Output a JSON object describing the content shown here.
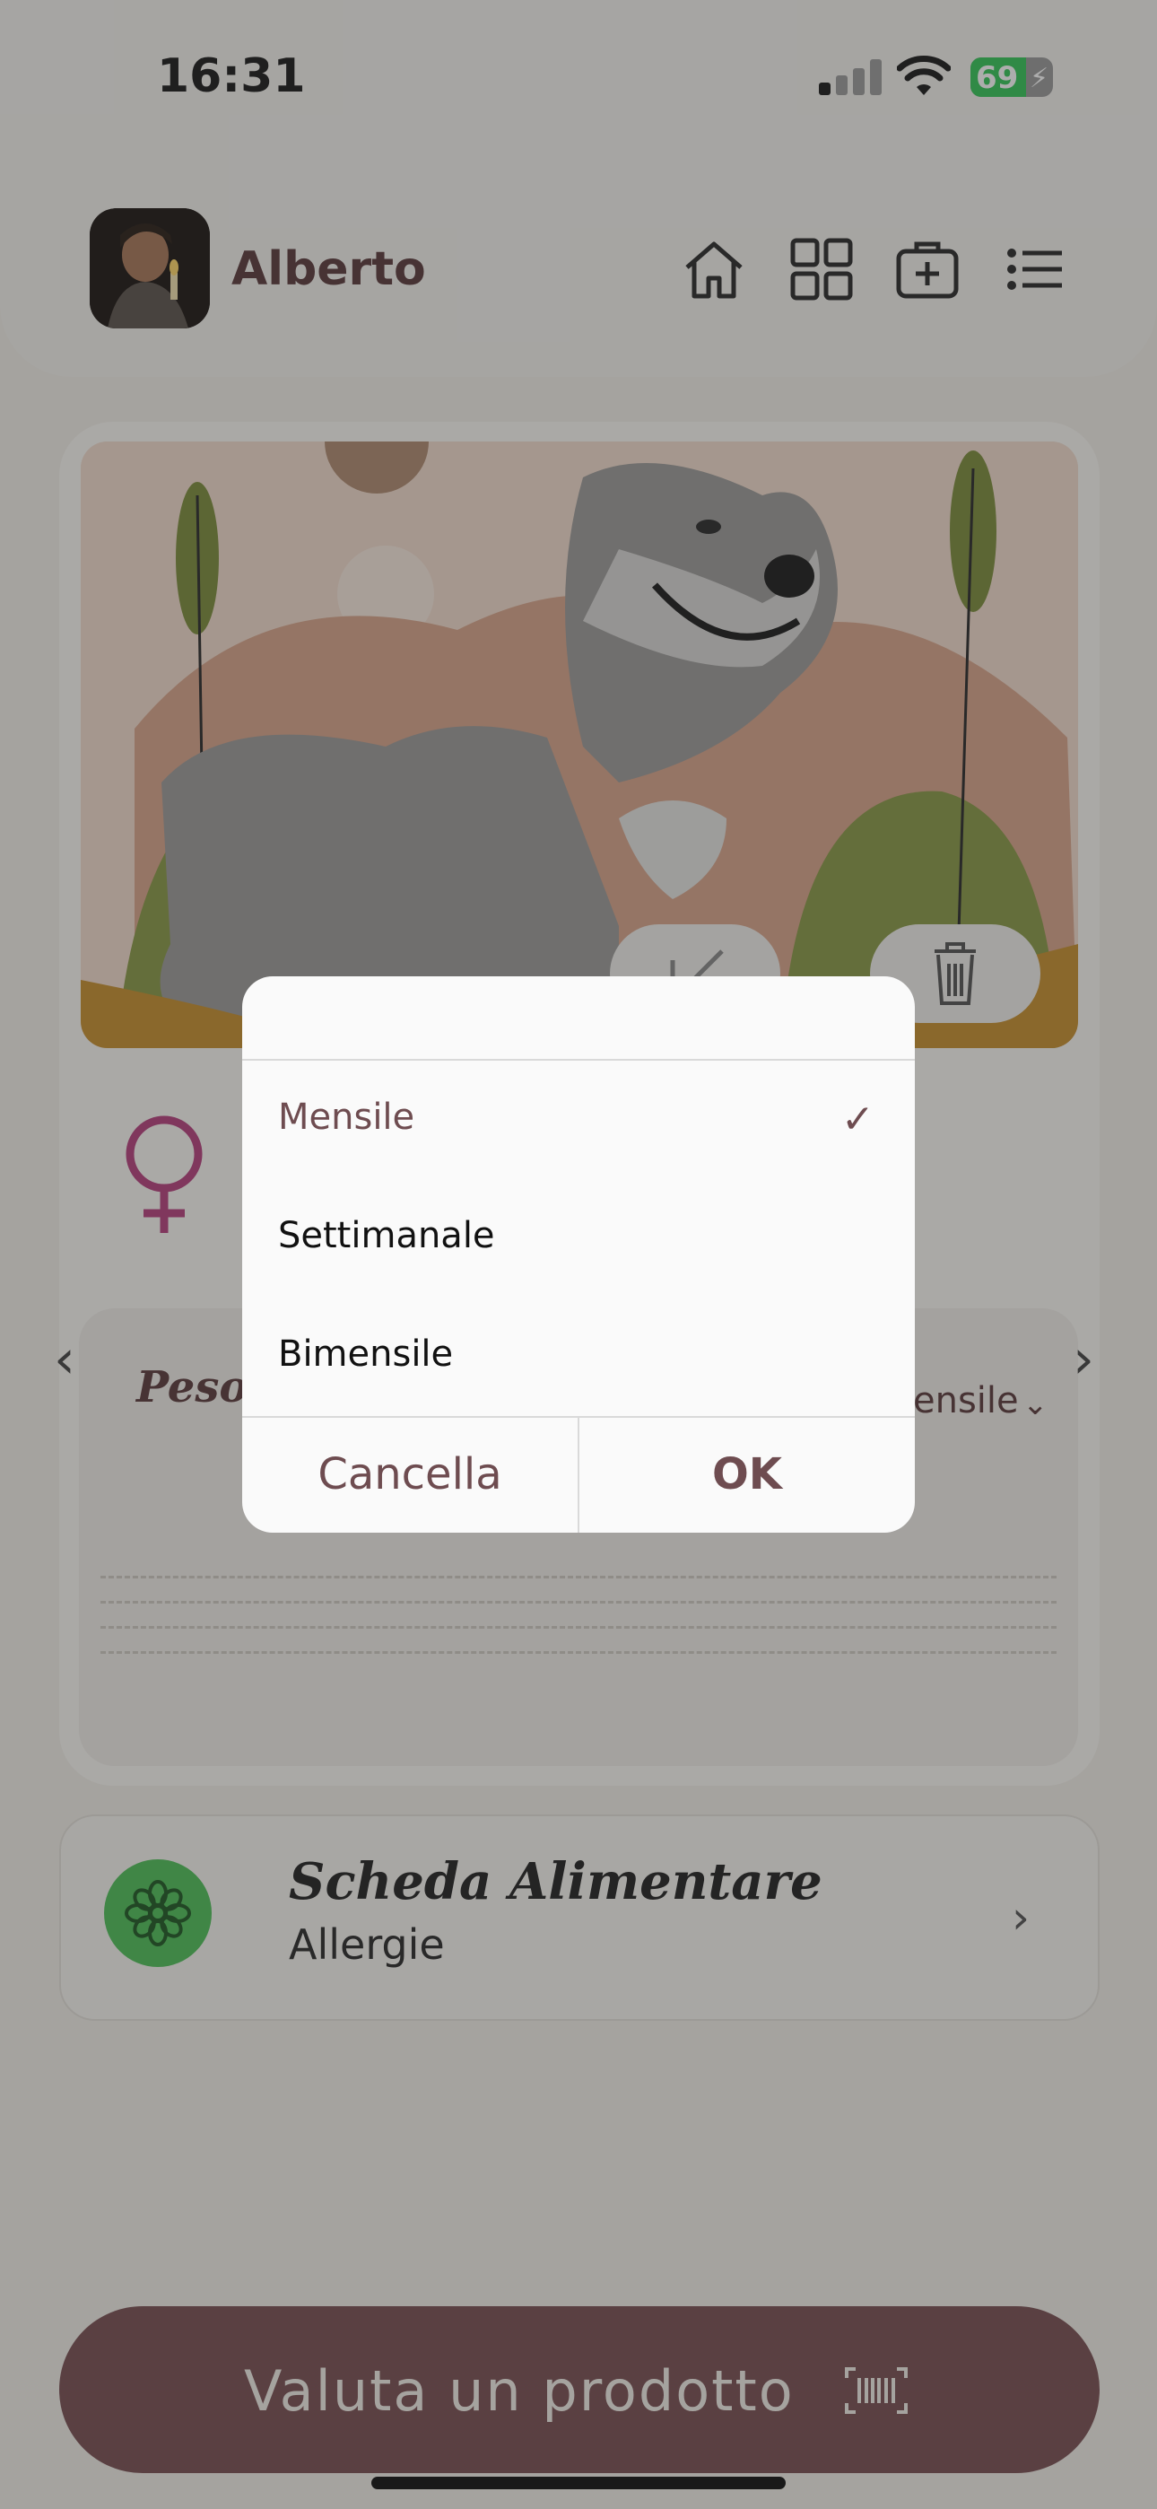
{
  "status_bar": {
    "time": "16:31",
    "battery": "69"
  },
  "header": {
    "username": "Alberto",
    "icons": [
      "home-icon",
      "grid-icon",
      "add-medical-icon",
      "list-icon"
    ]
  },
  "pet": {
    "gender_icon": "female-icon",
    "art_buttons": [
      "edit-icon",
      "trash-icon"
    ]
  },
  "weight": {
    "title": "Peso",
    "period_value": "ensile"
  },
  "food_card": {
    "title": "Scheda Alimentare",
    "subtitle": "Allergie",
    "icon": "flower-icon"
  },
  "cta": {
    "label": "Valuta un prodotto",
    "icon": "barcode-icon"
  },
  "dialog": {
    "options": [
      {
        "label": "Mensile",
        "selected": true
      },
      {
        "label": "Settimanale",
        "selected": false
      },
      {
        "label": "Bimensile",
        "selected": false
      }
    ],
    "cancel_label": "Cancella",
    "ok_label": "OK"
  }
}
